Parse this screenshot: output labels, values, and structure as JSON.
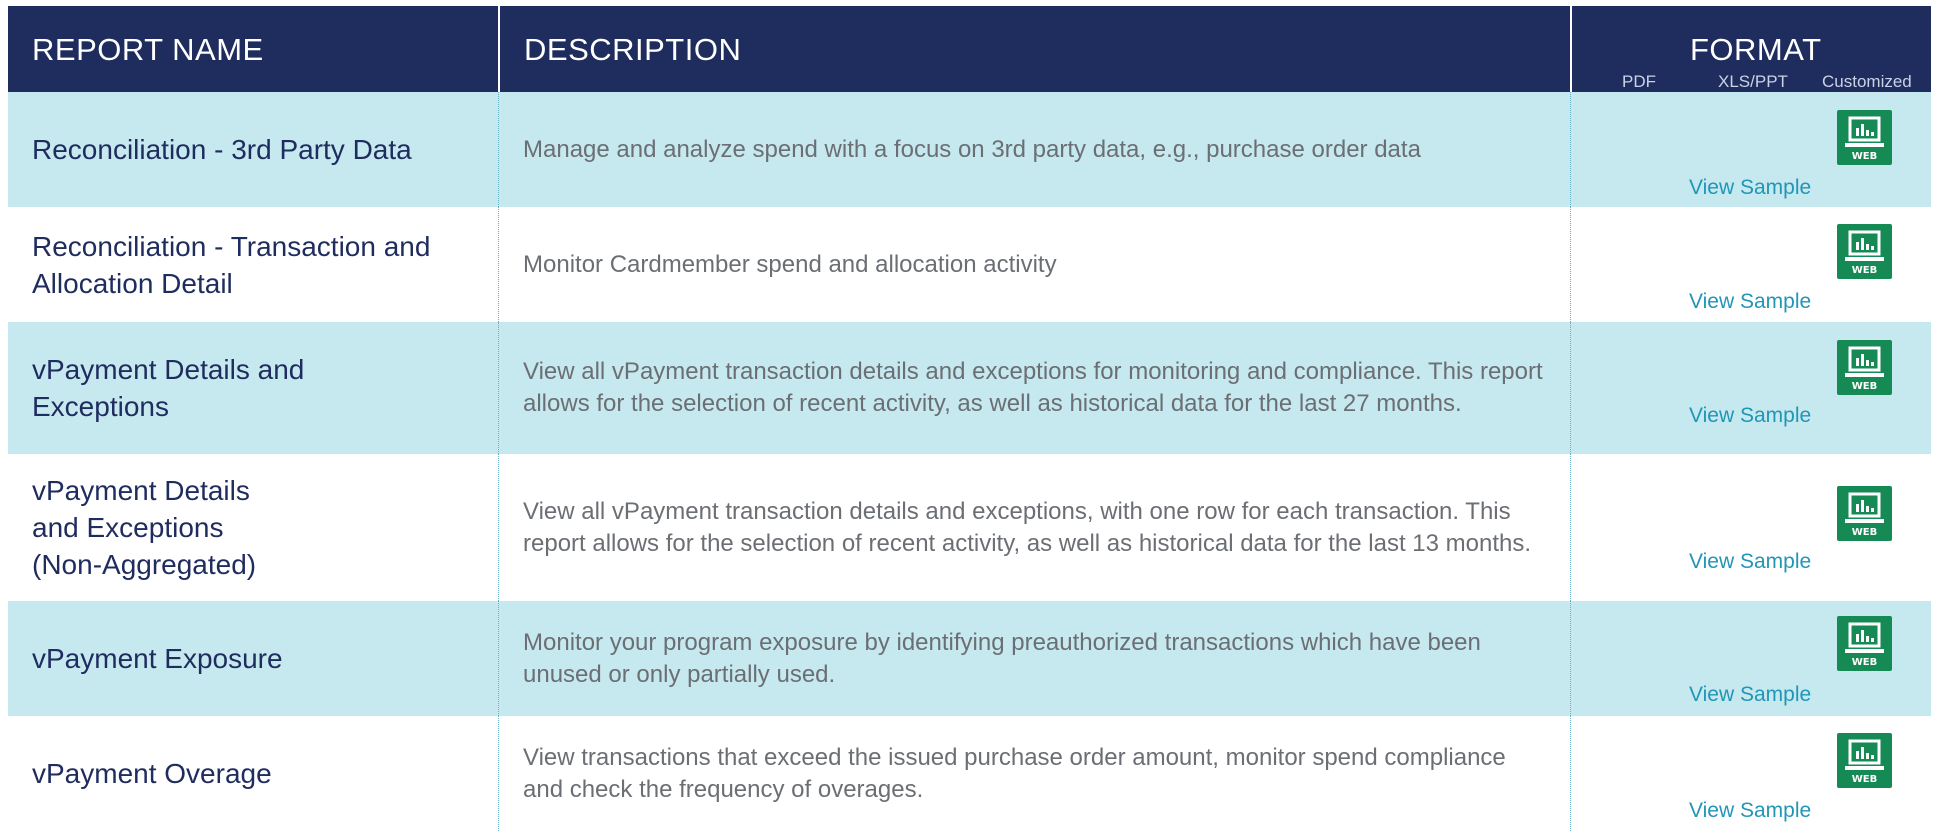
{
  "header": {
    "report_name": "REPORT NAME",
    "description": "DESCRIPTION",
    "format": "FORMAT",
    "format_sub": {
      "pdf": "PDF",
      "xls": "XLS/PPT",
      "custom": "Customized"
    }
  },
  "colors": {
    "header_bg": "#1f2c5e",
    "row_alt_bg": "#c6e8ef",
    "name_text": "#1f2c5e",
    "desc_text": "#6b6f74",
    "link": "#2196b6",
    "web_icon": "#168a55"
  },
  "rows": [
    {
      "name": "Reconciliation - 3rd Party Data",
      "description": "Manage and analyze spend with a focus on 3rd party data, e.g., purchase order data",
      "icon": "web-report-icon",
      "icon_label": "WEB",
      "link": "View Sample"
    },
    {
      "name": "Reconciliation - Transaction and\nAllocation Detail",
      "description": "Monitor Cardmember spend and allocation activity",
      "icon": "web-report-icon",
      "icon_label": "WEB",
      "link": "View Sample"
    },
    {
      "name": "vPayment Details and\nExceptions",
      "description": "View all vPayment transaction details and exceptions for monitoring and compliance. This report allows for the selection of recent activity, as well as historical data for the last 27 months.",
      "icon": "web-report-icon",
      "icon_label": "WEB",
      "link": "View Sample"
    },
    {
      "name": "vPayment Details\nand Exceptions\n(Non-Aggregated)",
      "description": "View all vPayment transaction details and exceptions, with one row for each transaction. This report allows for the selection of recent activity, as well as historical data for the last 13 months.",
      "icon": "web-report-icon",
      "icon_label": "WEB",
      "link": "View Sample"
    },
    {
      "name": "vPayment Exposure",
      "description": "Monitor your program exposure by identifying preauthorized transactions which have been unused or only partially used.",
      "icon": "web-report-icon",
      "icon_label": "WEB",
      "link": "View Sample"
    },
    {
      "name": "vPayment Overage",
      "description": "View transactions that exceed the issued purchase order amount, monitor spend compliance and check the frequency of overages.",
      "icon": "web-report-icon",
      "icon_label": "WEB",
      "link": "View Sample"
    }
  ]
}
